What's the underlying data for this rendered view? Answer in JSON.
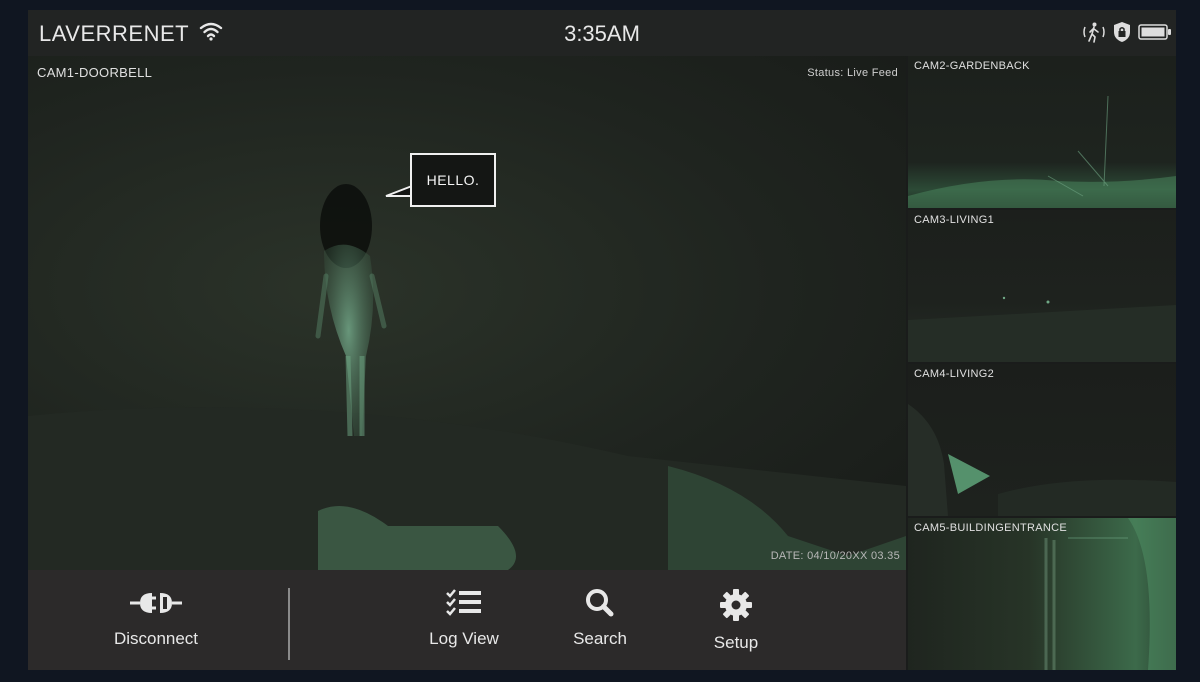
{
  "topbar": {
    "network_name": "LAVERRENET",
    "time": "3:35AM",
    "icons": [
      "wifi-icon",
      "motion-walk-icon",
      "shield-lock-icon",
      "battery-icon"
    ]
  },
  "main_camera": {
    "name": "CAM1-DOORBELL",
    "status": "Status: Live Feed",
    "date": "DATE: 04/10/20XX 03.35",
    "speech_bubble": "HELLO."
  },
  "toolbar": {
    "disconnect_label": "Disconnect",
    "log_view_label": "Log View",
    "search_label": "Search",
    "setup_label": "Setup"
  },
  "side_cameras": [
    {
      "name": "CAM2-GARDENBACK"
    },
    {
      "name": "CAM3-LIVING1"
    },
    {
      "name": "CAM4-LIVING2"
    },
    {
      "name": "CAM5-BUILDINGENTRANCE"
    }
  ],
  "colors": {
    "night_vision_green": "#5fa47a",
    "toolbar_bg": "#2c2a2a",
    "topbar_bg": "#222423"
  }
}
